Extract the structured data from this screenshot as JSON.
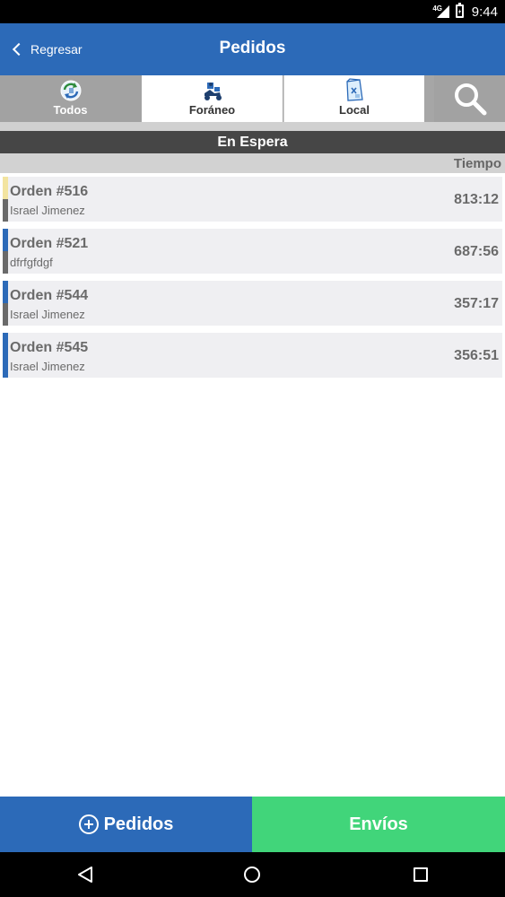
{
  "status_bar": {
    "network": "4G",
    "time": "9:44"
  },
  "header": {
    "back_label": "Regresar",
    "title": "Pedidos"
  },
  "tabs": [
    {
      "label": "Todos",
      "icon": "refresh-orders-icon",
      "selected": true
    },
    {
      "label": "Foráneo",
      "icon": "delivery-scooter-icon",
      "selected": false
    },
    {
      "label": "Local",
      "icon": "takeout-bag-icon",
      "selected": false
    }
  ],
  "search": {
    "icon": "search-icon"
  },
  "section": {
    "title": "En Espera",
    "time_column": "Tiempo"
  },
  "orders": [
    {
      "title": "Orden #516",
      "customer": "Israel Jimenez",
      "time": "813:12",
      "stripe_top": "#f3e4a0",
      "stripe_bottom": "#6a6a6a"
    },
    {
      "title": "Orden #521",
      "customer": "dfrfgfdgf",
      "time": "687:56",
      "stripe_top": "#2c6ab8",
      "stripe_bottom": "#6a6a6a"
    },
    {
      "title": "Orden #544",
      "customer": "Israel Jimenez",
      "time": "357:17",
      "stripe_top": "#2c6ab8",
      "stripe_bottom": "#6a6a6a"
    },
    {
      "title": "Orden #545",
      "customer": "Israel Jimenez",
      "time": "356:51",
      "stripe_top": "#2c6ab8",
      "stripe_bottom": "#2c6ab8"
    }
  ],
  "bottom": {
    "pedidos_label": "Pedidos",
    "envios_label": "Envíos"
  },
  "colors": {
    "primary": "#2c6ab8",
    "accent_green": "#41d57a",
    "section_dark": "#464646"
  }
}
